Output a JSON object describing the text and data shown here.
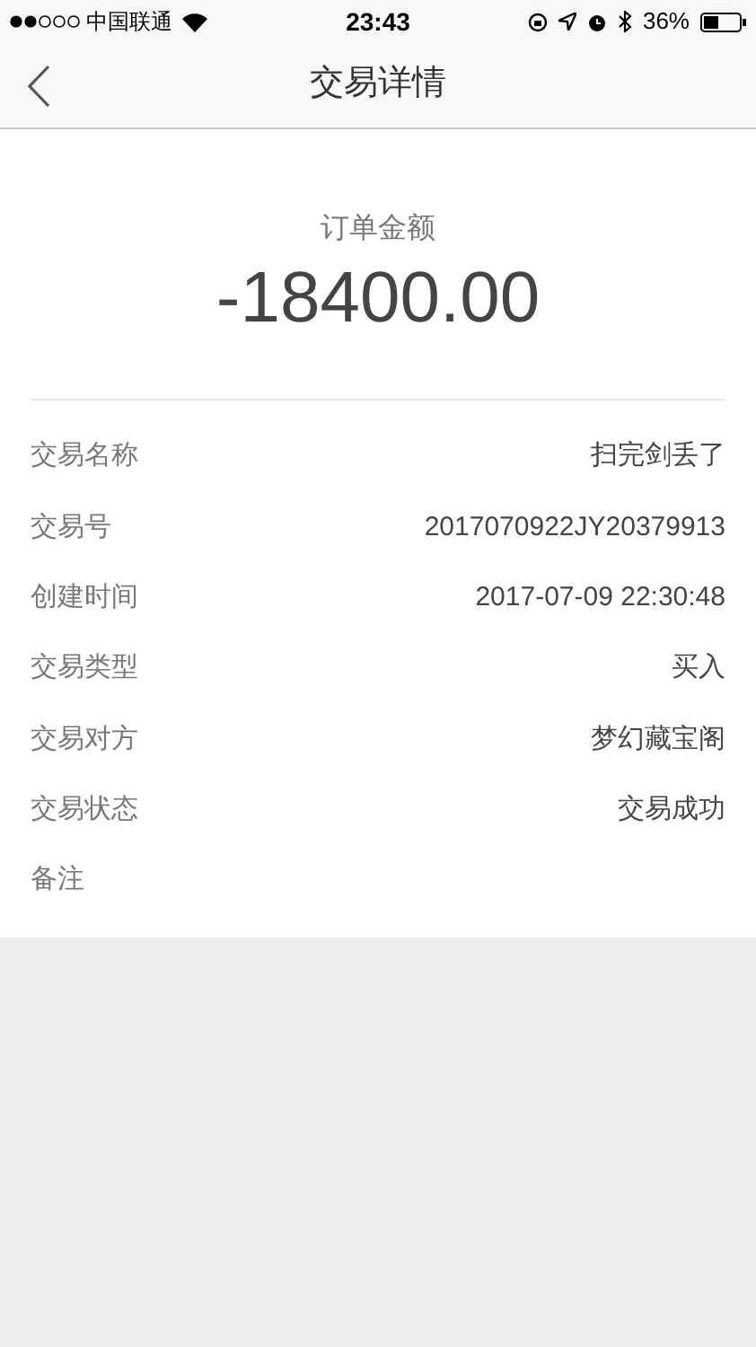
{
  "status_bar": {
    "carrier": "中国联通",
    "time": "23:43",
    "battery": "36%"
  },
  "nav": {
    "title": "交易详情"
  },
  "amount": {
    "label": "订单金额",
    "value": "-18400.00"
  },
  "rows": [
    {
      "label": "交易名称",
      "value": "扫完剑丢了"
    },
    {
      "label": "交易号",
      "value": "2017070922JY20379913"
    },
    {
      "label": "创建时间",
      "value": "2017-07-09 22:30:48"
    },
    {
      "label": "交易类型",
      "value": "买入"
    },
    {
      "label": "交易对方",
      "value": "梦幻藏宝阁"
    },
    {
      "label": "交易状态",
      "value": "交易成功"
    },
    {
      "label": "备注"
    }
  ]
}
